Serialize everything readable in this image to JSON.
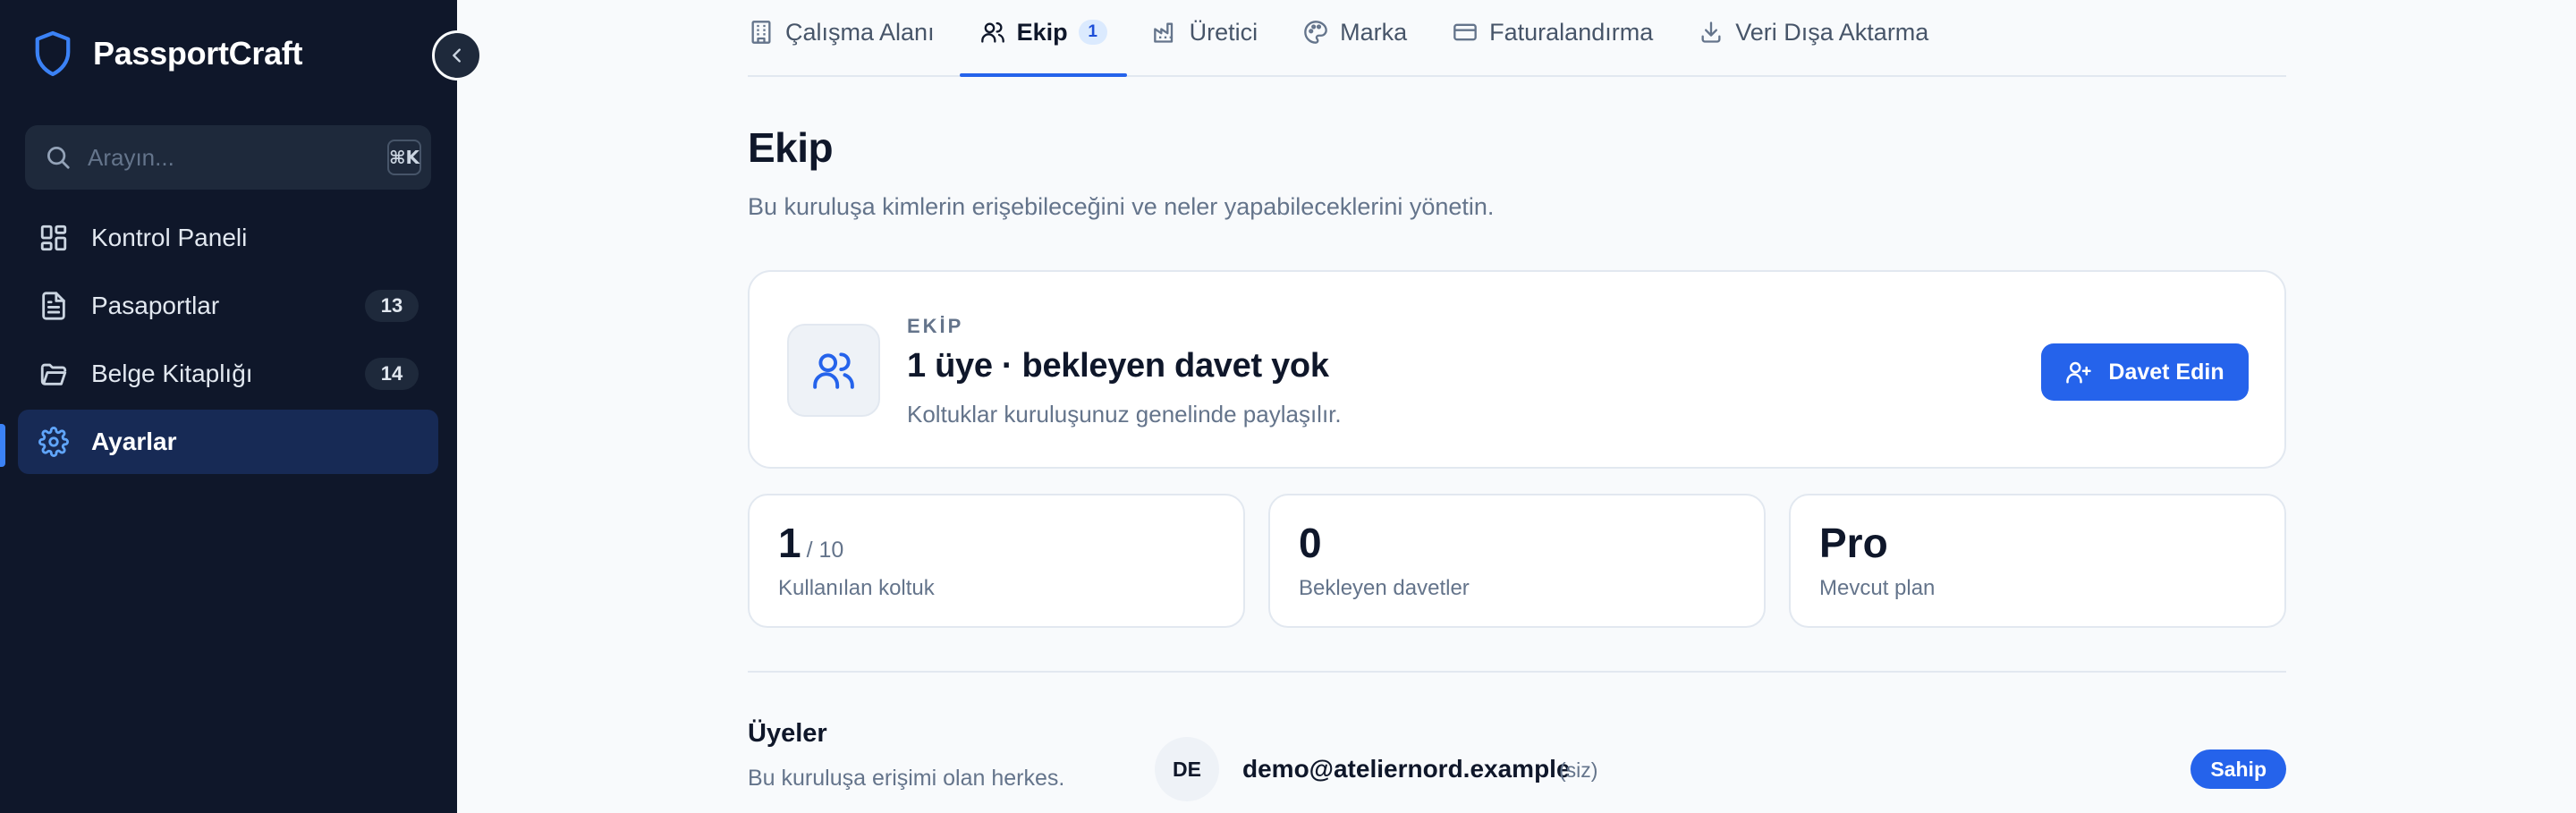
{
  "sidebar": {
    "brand_name": "PassportCraft",
    "search": {
      "placeholder": "Arayın...",
      "shortcut": "⌘K"
    },
    "items": [
      {
        "label": "Kontrol Paneli",
        "icon": "dashboard-icon",
        "badge": null,
        "active": false
      },
      {
        "label": "Pasaportlar",
        "icon": "document-icon",
        "badge": "13",
        "active": false
      },
      {
        "label": "Belge Kitaplığı",
        "icon": "folder-icon",
        "badge": "14",
        "active": false
      },
      {
        "label": "Ayarlar",
        "icon": "gear-icon",
        "badge": null,
        "active": true
      }
    ]
  },
  "tabs": [
    {
      "label": "Çalışma Alanı",
      "icon": "building-icon",
      "active": false
    },
    {
      "label": "Ekip",
      "icon": "users-icon",
      "active": true,
      "badge": "1"
    },
    {
      "label": "Üretici",
      "icon": "factory-icon",
      "active": false
    },
    {
      "label": "Marka",
      "icon": "palette-icon",
      "active": false
    },
    {
      "label": "Faturalandırma",
      "icon": "credit-card-icon",
      "active": false
    },
    {
      "label": "Veri Dışa Aktarma",
      "icon": "download-icon",
      "active": false
    }
  ],
  "page": {
    "title": "Ekip",
    "subtitle": "Bu kuruluşa kimlerin erişebileceğini ve neler yapabileceklerini yönetin."
  },
  "team_card": {
    "kicker": "EKİP",
    "headline": "1 üye · bekleyen davet yok",
    "note": "Koltuklar kuruluşunuz genelinde paylaşılır.",
    "invite_label": "Davet Edin"
  },
  "stats": [
    {
      "value": "1",
      "suffix": "/ 10",
      "label": "Kullanılan koltuk"
    },
    {
      "value": "0",
      "suffix": "",
      "label": "Bekleyen davetler"
    },
    {
      "value": "Pro",
      "suffix": "",
      "label": "Mevcut plan"
    }
  ],
  "members": {
    "title": "Üyeler",
    "subtitle": "Bu kuruluşa erişimi olan herkes.",
    "list": [
      {
        "initials": "DE",
        "email": "demo@ateliernord.example",
        "you_label": "(siz)",
        "role": "Sahip"
      }
    ]
  },
  "colors": {
    "sidebar_bg": "#0f172a",
    "accent": "#2563eb",
    "active_nav_bg": "#172a55",
    "page_bg": "#f8fafc"
  }
}
